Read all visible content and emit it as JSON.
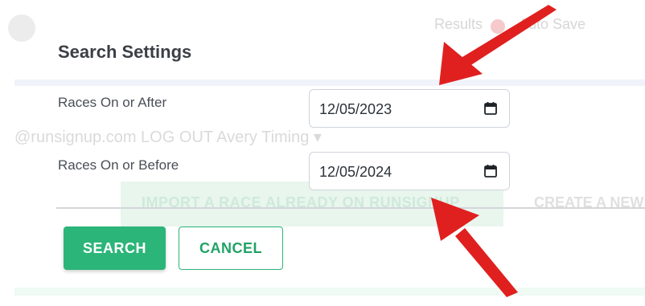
{
  "background": {
    "topbar_text": "Results",
    "topbar_text2": "Auto Save",
    "user_line": "@runsignup.com  LOG OUT    Avery Timing ▾",
    "import_button": "IMPORT A RACE ALREADY ON RUNSIGNUP",
    "create_button": "CREATE A NEW"
  },
  "dialog": {
    "title": "Search Settings",
    "fields": [
      {
        "label": "Races On or After",
        "value": "12/05/2023",
        "icon": "calendar-icon"
      },
      {
        "label": "Races On or Before",
        "value": "12/05/2024",
        "icon": "calendar-icon"
      }
    ],
    "search_label": "SEARCH",
    "cancel_label": "CANCEL"
  },
  "colors": {
    "primary": "#2bb579",
    "annotation_arrow": "#e0201f"
  }
}
